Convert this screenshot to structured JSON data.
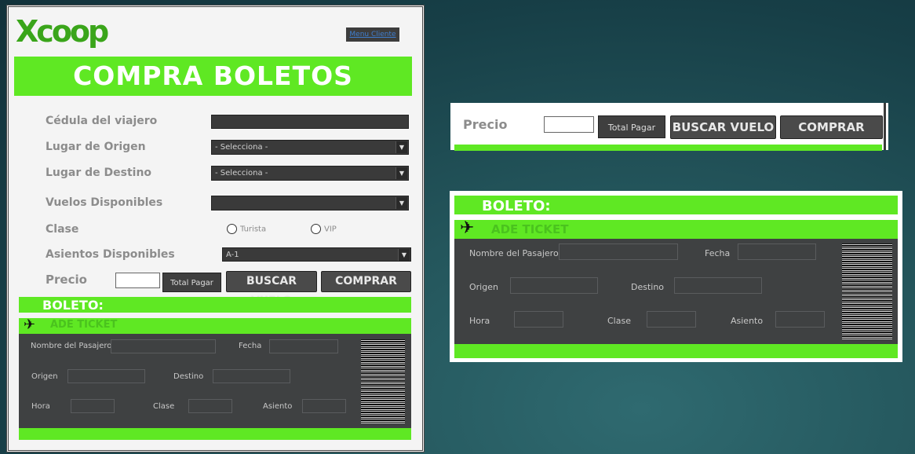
{
  "app": {
    "logo_text": "Xcoop",
    "menu_link": "Menu Cliente",
    "banner_title": "COMPRA BOLETOS"
  },
  "form": {
    "cedula_label": "Cédula del viajero",
    "origen_label": "Lugar de Origen",
    "origen_value": "- Selecciona -",
    "destino_label": "Lugar de Destino",
    "destino_value": "- Selecciona -",
    "vuelos_label": "Vuelos Disponibles",
    "vuelos_value": "",
    "clase_label": "Clase",
    "clase_options": [
      "Turista",
      "VIP"
    ],
    "asientos_label": "Asientos Disponibles",
    "asientos_value": "A-1",
    "precio_label": "Precio",
    "total_pagar": "Total Pagar",
    "buscar_vuelo": "BUSCAR VUELO",
    "comprar": "COMPRAR"
  },
  "ticket": {
    "section_title": "BOLETO:",
    "header_text": "ADE TICKET",
    "nombre_label": "Nombre del Pasajero",
    "fecha_label": "Fecha",
    "origen_label": "Origen",
    "destino_label": "Destino",
    "hora_label": "Hora",
    "clase_label": "Clase",
    "asiento_label": "Asiento"
  },
  "colors": {
    "accent_green": "#5fe823",
    "dark_panel": "#3f4142",
    "background_teal": "#24565c"
  },
  "icons": {
    "plane": "airplane-icon",
    "dropdown": "chevron-down-icon"
  }
}
